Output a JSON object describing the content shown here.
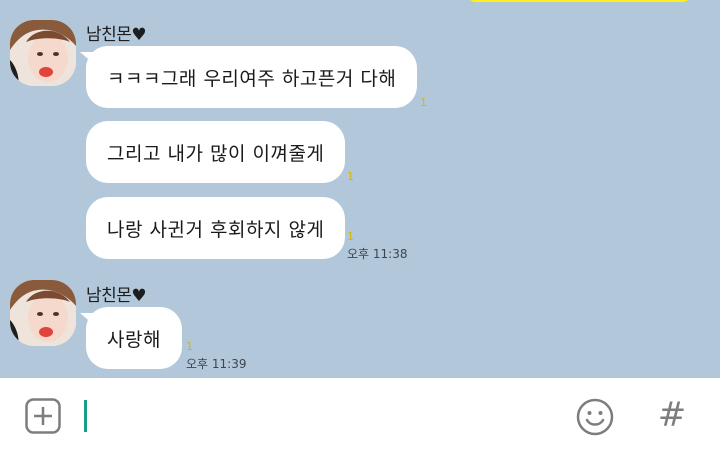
{
  "conversation": {
    "groups": [
      {
        "sender": "남친몬♥",
        "messages": [
          {
            "text": "ㅋㅋㅋ그래 우리여주 하고픈거 다해",
            "unread": "1",
            "time": ""
          },
          {
            "text": "그리고 내가 많이 이껴줄게",
            "unread": "1",
            "time": ""
          },
          {
            "text": "나랑 사귄거 후회하지 않게",
            "unread": "1",
            "time": "오후 11:38"
          }
        ]
      },
      {
        "sender": "남친몬♥",
        "messages": [
          {
            "text": "사랑해",
            "unread": "1",
            "time": "오후 11:39"
          }
        ]
      }
    ]
  },
  "input_bar": {
    "plus_icon": "plus-square-icon",
    "emoji_icon": "smiley-icon",
    "hash_label": "#"
  },
  "colors": {
    "chat_background": "#b2c7d9",
    "bubble": "#ffffff",
    "unread": "#d4b900",
    "cursor": "#1a9e8c"
  }
}
